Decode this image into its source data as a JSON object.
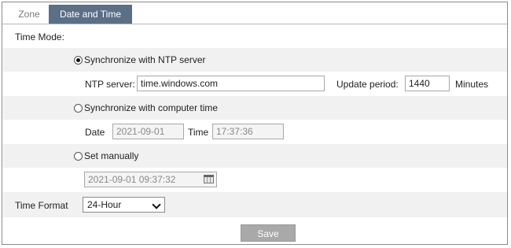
{
  "tabs": {
    "zone": "Zone",
    "date_time": "Date and Time"
  },
  "time_mode": {
    "label": "Time Mode:",
    "options": [
      {
        "label": "Synchronize with NTP server",
        "selected": true
      },
      {
        "label": "Synchronize with computer time",
        "selected": false
      },
      {
        "label": "Set manually",
        "selected": false
      }
    ]
  },
  "ntp": {
    "server_label": "NTP server:",
    "server_value": "time.windows.com",
    "update_label": "Update period:",
    "update_value": "1440",
    "unit": "Minutes"
  },
  "computer_time": {
    "date_label": "Date",
    "date_value": "2021-09-01",
    "time_label": "Time",
    "time_value": "17:37:36"
  },
  "manual": {
    "datetime_value": "2021-09-01 09:37:32"
  },
  "time_format": {
    "label": "Time Format",
    "selected": "24-Hour"
  },
  "save_label": "Save",
  "colors": {
    "active_tab": "#5b6f86",
    "row_shade": "#f1f1f1",
    "button": "#a9a9a9"
  }
}
